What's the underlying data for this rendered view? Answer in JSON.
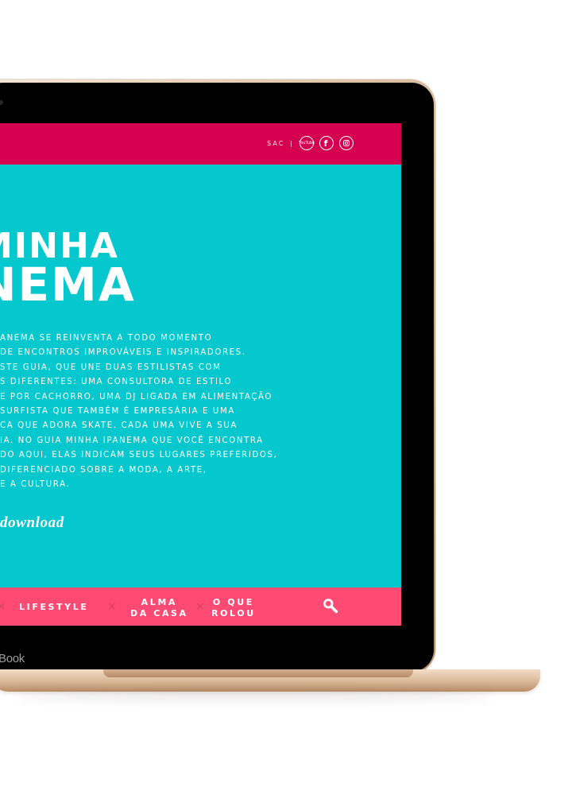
{
  "topbar": {
    "sac_label": "SAC",
    "divider": "|",
    "social": [
      {
        "name": "youtube-icon",
        "label_top": "You",
        "label_bottom": "Tube"
      },
      {
        "name": "facebook-icon",
        "label": "f"
      },
      {
        "name": "instagram-icon"
      }
    ]
  },
  "hero": {
    "line_1": "MINHA",
    "line_2": "NEMA"
  },
  "description_lines": [
    "ANEMA SE REINVENTA A TODO MOMENTO",
    "DE ENCONTROS IMPROVÁVEIS E INSPIRADORES.",
    "STE GUIA, QUE UNE DUAS ESTILISTAS COM",
    "S DIFERENTES: UMA CONSULTORA DE ESTILO",
    "E POR CACHORRO, UMA DJ LIGADA EM ALIMENTAÇÃO",
    "SURFISTA QUE TAMBÉM É EMPRESÁRIA E UMA",
    "CA QUE ADORA SKATE. CADA UMA VIVE A SUA",
    "IA. NO GUIA MINHA IPANEMA QUE VOCÊ ENCONTRA",
    "DO AQUI, ELAS INDICAM SEUS LUGARES PREFERIDOS,",
    "DIFERENCIADO SOBRE A MODA, A ARTE,",
    "E A CULTURA."
  ],
  "download_label": "download",
  "bottom_nav": {
    "separator": "×",
    "items": [
      {
        "label": "LIFESTYLE"
      },
      {
        "label_line_1": "ALMA",
        "label_line_2": "DA CASA"
      },
      {
        "label_line_1": "O QUE",
        "label_line_2": "ROLOU"
      }
    ]
  },
  "laptop_brand": "Book",
  "colors": {
    "turquoise": "#05c8cf",
    "top_pink": "#d5004f",
    "bottom_pink": "#ff4a73",
    "text_white": "#ffffff"
  }
}
